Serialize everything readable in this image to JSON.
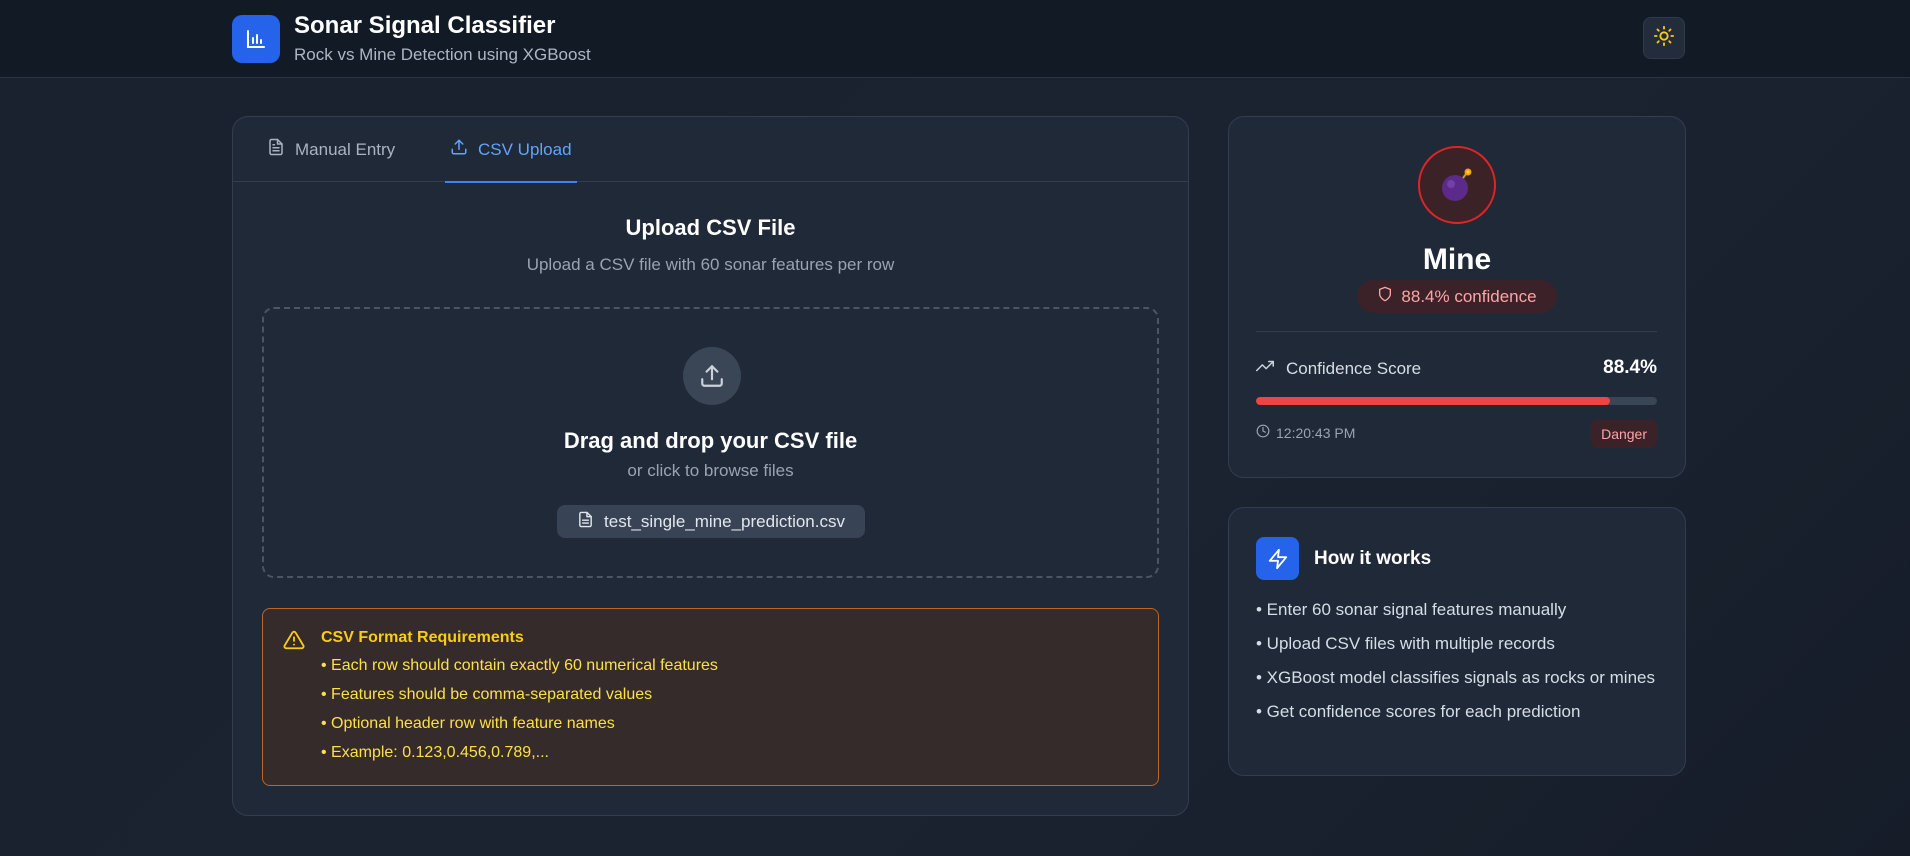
{
  "header": {
    "title": "Sonar Signal Classifier",
    "subtitle": "Rock vs Mine Detection using XGBoost",
    "logo_icon": "bar-chart-icon",
    "theme_icon": "sun-icon"
  },
  "tabs": [
    {
      "label": "Manual Entry",
      "icon": "document-icon",
      "active": false
    },
    {
      "label": "CSV Upload",
      "icon": "upload-icon",
      "active": true
    }
  ],
  "upload": {
    "title": "Upload CSV File",
    "subtitle": "Upload a CSV file with 60 sonar features per row",
    "drop_title": "Drag and drop your CSV file",
    "drop_subtitle": "or click to browse files",
    "file_name": "test_single_mine_prediction.csv"
  },
  "requirements": {
    "title": "CSV Format Requirements",
    "items": [
      "• Each row should contain exactly 60 numerical features",
      "• Features should be comma-separated values",
      "• Optional header row with feature names",
      "• Example: 0.123,0.456,0.789,..."
    ]
  },
  "result": {
    "label": "Mine",
    "icon": "bomb-icon",
    "confidence_text": "88.4% confidence",
    "score_label": "Confidence Score",
    "score_value": "88.4%",
    "score_fraction": 0.884,
    "time": "12:20:43 PM",
    "status": "Danger"
  },
  "how": {
    "title": "How it works",
    "items": [
      "• Enter 60 sonar signal features manually",
      "• Upload CSV files with multiple records",
      "• XGBoost model classifies signals as rocks or mines",
      "• Get confidence scores for each prediction"
    ]
  },
  "colors": {
    "accent": "#3b82f6",
    "danger": "#ef4444",
    "warning": "#facc15"
  }
}
